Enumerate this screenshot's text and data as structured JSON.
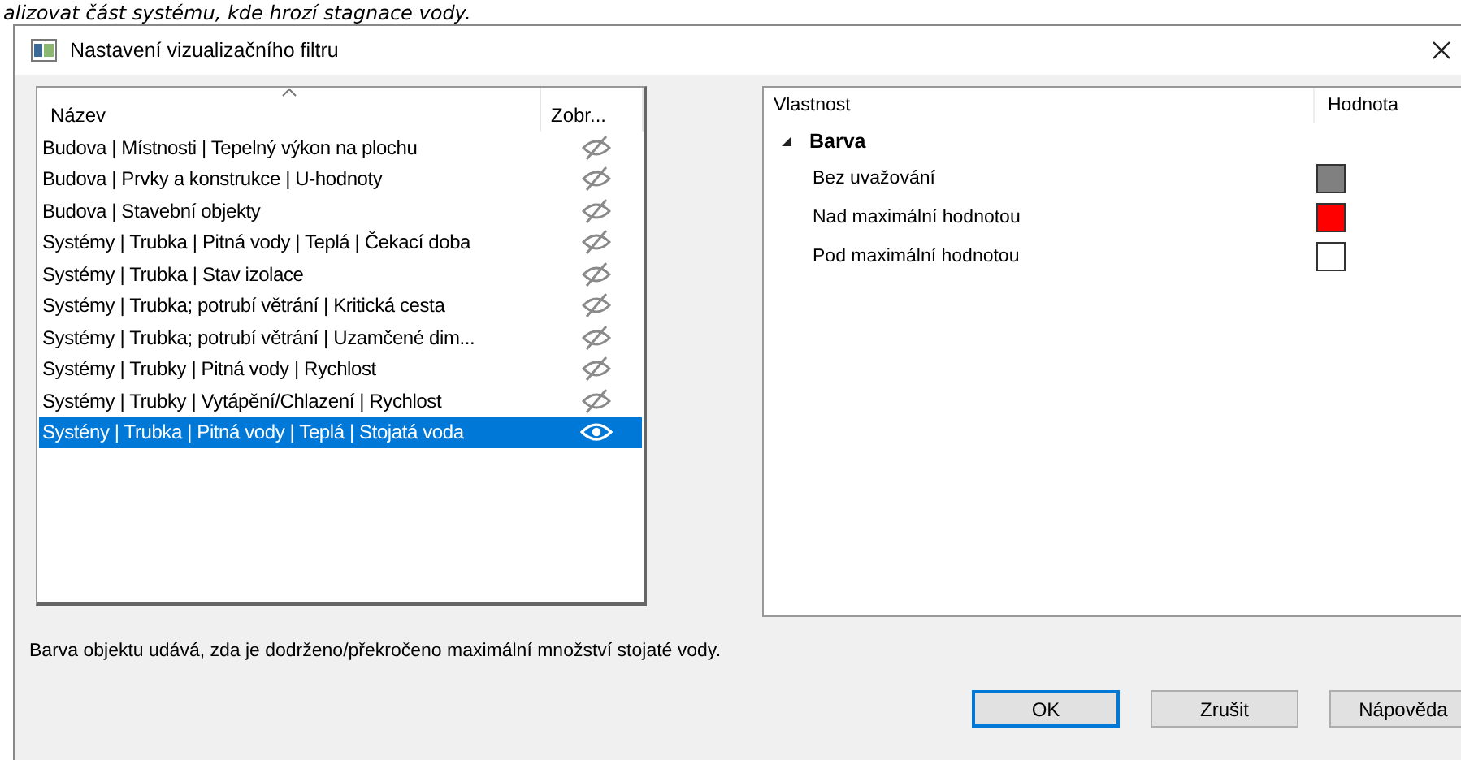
{
  "background_text": "alizovat část systému, kde hrozí stagnace vody.",
  "window": {
    "title": "Nastavení vizualizačního filtru"
  },
  "filter_list": {
    "columns": [
      "Název",
      "Zobr..."
    ],
    "rows": [
      {
        "name": "Budova | Místnosti | Tepelný výkon na plochu",
        "visible": false,
        "selected": false
      },
      {
        "name": "Budova | Prvky a konstrukce | U-hodnoty",
        "visible": false,
        "selected": false
      },
      {
        "name": "Budova | Stavební objekty",
        "visible": false,
        "selected": false
      },
      {
        "name": "Systémy | Trubka | Pitná vody | Teplá | Čekací doba",
        "visible": false,
        "selected": false
      },
      {
        "name": "Systémy | Trubka | Stav izolace",
        "visible": false,
        "selected": false
      },
      {
        "name": "Systémy | Trubka; potrubí větrání | Kritická cesta",
        "visible": false,
        "selected": false
      },
      {
        "name": "Systémy | Trubka; potrubí větrání | Uzamčené dim...",
        "visible": false,
        "selected": false
      },
      {
        "name": "Systémy | Trubky | Pitná vody | Rychlost",
        "visible": false,
        "selected": false
      },
      {
        "name": "Systémy | Trubky | Vytápění/Chlazení | Rychlost",
        "visible": false,
        "selected": false
      },
      {
        "name": "Systény | Trubka | Pitná vody | Teplá | Stojatá voda",
        "visible": true,
        "selected": true
      }
    ]
  },
  "properties": {
    "columns": [
      "Vlastnost",
      "Hodnota"
    ],
    "group": {
      "name": "Barva",
      "expanded": true,
      "items": [
        {
          "name": "Bez uvažování",
          "color": "#808080"
        },
        {
          "name": "Nad maximální hodnotou",
          "color": "#ff0000"
        },
        {
          "name": "Pod maximální hodnotou",
          "color": "#ffffff"
        }
      ]
    }
  },
  "description": "Barva objektu udává, zda je dodrženo/překročeno maximální množství stojaté vody.",
  "buttons": [
    {
      "label": "OK",
      "default": true
    },
    {
      "label": "Zrušit",
      "default": false
    },
    {
      "label": "Nápověda",
      "default": false
    }
  ]
}
